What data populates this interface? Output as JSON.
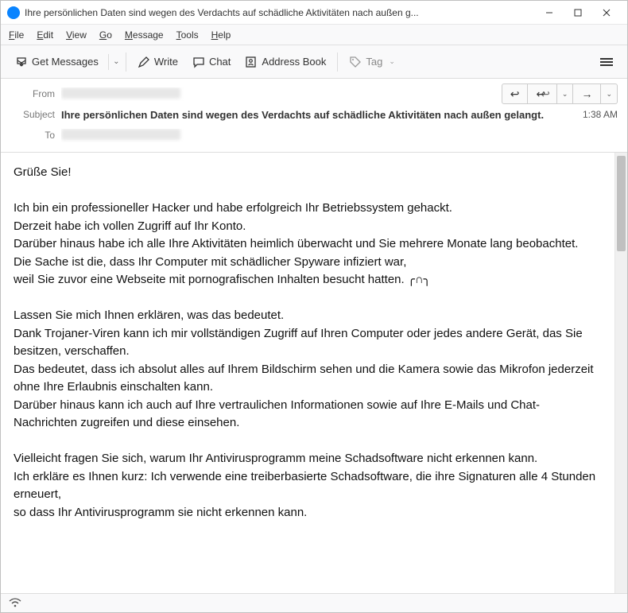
{
  "window": {
    "title": "Ihre persönlichen Daten sind wegen des Verdachts auf schädliche Aktivitäten nach außen g..."
  },
  "menu": {
    "file": "File",
    "edit": "Edit",
    "view": "View",
    "go": "Go",
    "message": "Message",
    "tools": "Tools",
    "help": "Help"
  },
  "toolbar": {
    "get_messages": "Get Messages",
    "write": "Write",
    "chat": "Chat",
    "address_book": "Address Book",
    "tag": "Tag"
  },
  "headers": {
    "from_label": "From",
    "from_value": "",
    "subject_label": "Subject",
    "subject_value": "Ihre persönlichen Daten sind wegen des Verdachts auf schädliche Aktivitäten nach außen gelangt.",
    "to_label": "To",
    "to_value": "",
    "time": "1:38 AM"
  },
  "body": {
    "p1": "Grüße Sie!",
    "p2": "Ich bin ein professioneller Hacker und habe erfolgreich Ihr Betriebssystem gehackt.",
    "p3": "Derzeit habe ich vollen Zugriff auf Ihr Konto.",
    "p4": "Darüber hinaus habe ich alle Ihre Aktivitäten heimlich überwacht und Sie mehrere Monate lang beobachtet.",
    "p5": "Die Sache ist die, dass Ihr Computer mit schädlicher Spyware infiziert war,",
    "p6": "weil Sie zuvor eine Webseite mit pornografischen Inhalten besucht hatten.  ╭∩╮",
    "p7": "Lassen Sie mich Ihnen erklären, was das bedeutet.",
    "p8": "Dank Trojaner-Viren kann ich mir vollständigen Zugriff auf Ihren Computer oder jedes andere Gerät, das Sie besitzen, verschaffen.",
    "p9": "Das bedeutet, dass ich absolut alles auf Ihrem Bildschirm sehen und die Kamera sowie das Mikrofon jederzeit ohne Ihre Erlaubnis einschalten kann.",
    "p10": "Darüber hinaus kann ich auch auf Ihre vertraulichen Informationen sowie auf Ihre E-Mails und Chat-Nachrichten zugreifen und diese einsehen.",
    "p11": "Vielleicht fragen Sie sich, warum Ihr Antivirusprogramm meine Schadsoftware nicht erkennen kann.",
    "p12": "Ich erkläre es Ihnen kurz: Ich verwende eine treiberbasierte Schadsoftware, die ihre Signaturen alle 4 Stunden erneuert,",
    "p13": "so dass Ihr Antivirusprogramm sie nicht erkennen kann."
  },
  "status": {
    "icon": "(⦿)"
  }
}
